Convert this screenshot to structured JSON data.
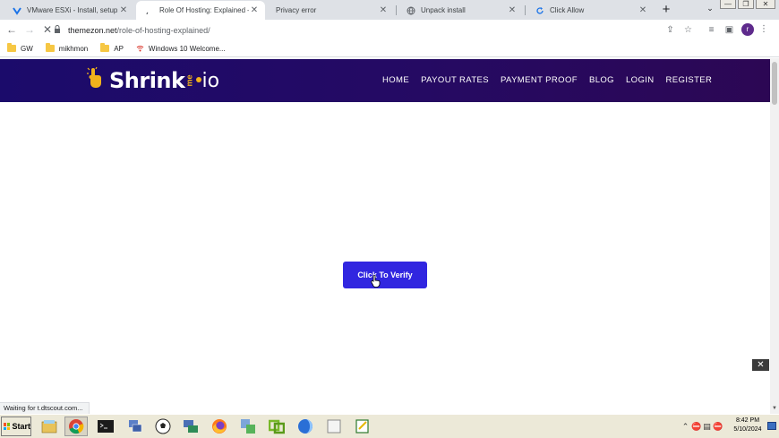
{
  "browser": {
    "tabs": [
      {
        "title": "VMware ESXi - Install, setup drive",
        "favicon": "vmware-icon",
        "active": false
      },
      {
        "title": "Role Of Hosting: Explained – The",
        "favicon": "loading-icon",
        "active": true
      },
      {
        "title": "Privacy error",
        "favicon": "none",
        "active": false
      },
      {
        "title": "Unpack install",
        "favicon": "globe-icon",
        "active": false
      },
      {
        "title": "Click Allow",
        "favicon": "reload-icon",
        "active": false
      }
    ],
    "close_glyph": "✕",
    "new_tab_glyph": "+",
    "tab_search_glyph": "⌄",
    "window_buttons": [
      "—",
      "❐",
      "✕"
    ],
    "address": {
      "host": "themezon.net",
      "path": "/role-of-hosting-explained/"
    },
    "nav": {
      "back": "←",
      "forward": "→",
      "stop": "✕"
    },
    "toolbar_icons": {
      "share": "⇪",
      "star": "☆",
      "reading_list": "≡",
      "side_panel": "▣",
      "menu": "⋮"
    },
    "profile_letter": "r",
    "bookmarks": [
      {
        "label": "GW",
        "icon": "folder-icon"
      },
      {
        "label": "mikhmon",
        "icon": "folder-icon"
      },
      {
        "label": "AP",
        "icon": "folder-icon"
      },
      {
        "label": "Windows 10 Welcome...",
        "icon": "wifi-icon"
      }
    ],
    "status": "Waiting for t.dtscout.com..."
  },
  "site": {
    "logo": {
      "word": "Shrink",
      "sub": "me",
      "tld": "io"
    },
    "nav": [
      "HOME",
      "PAYOUT RATES",
      "PAYMENT PROOF",
      "BLOG",
      "LOGIN",
      "REGISTER"
    ],
    "verify_button": "Click To Verify",
    "ad_close": "✕"
  },
  "taskbar": {
    "start_label": "Start",
    "apps": [
      {
        "name": "file-manager-icon",
        "glyph": "🗂"
      },
      {
        "name": "chrome-icon",
        "glyph": "◉"
      },
      {
        "name": "terminal-icon",
        "glyph": "▪"
      },
      {
        "name": "network-icon",
        "glyph": "🖧"
      },
      {
        "name": "soccer-ball-icon",
        "glyph": "⚽"
      },
      {
        "name": "remote-desktop-icon",
        "glyph": "🖥"
      },
      {
        "name": "firefox-icon",
        "glyph": "🦊"
      },
      {
        "name": "transfer-icon",
        "glyph": "⇄"
      },
      {
        "name": "vmware-icon",
        "glyph": "◈"
      },
      {
        "name": "browser-icon",
        "glyph": "◐"
      },
      {
        "name": "blank-window-icon",
        "glyph": "▢"
      },
      {
        "name": "notepad-icon",
        "glyph": "✎"
      }
    ],
    "tray_icons": [
      "⌃",
      "⛔",
      "▤",
      "⛔"
    ],
    "time": "8:42 PM",
    "date": "5/10/2024"
  },
  "colors": {
    "header_start": "#1b0b6b",
    "header_end": "#2c0754",
    "verify_button": "#3126e0",
    "logo_accent": "#f2b21c"
  }
}
